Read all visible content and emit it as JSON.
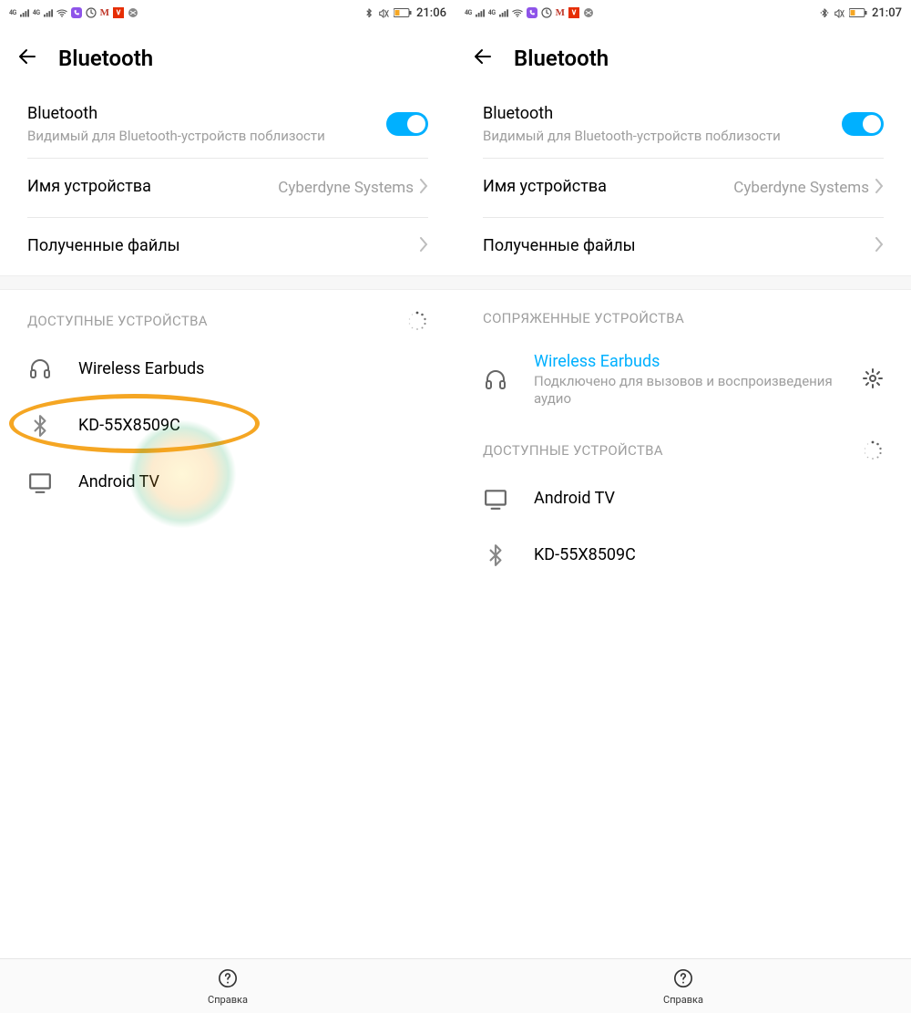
{
  "left": {
    "statusbar": {
      "time": "21:06"
    },
    "page_title": "Bluetooth",
    "toggle": {
      "title": "Bluetooth",
      "subtitle": "Видимый для Bluetooth-устройств поблизости"
    },
    "device_name_row": {
      "label": "Имя устройства",
      "value": "Cyberdyne Systems"
    },
    "received_files_row": {
      "label": "Полученные файлы"
    },
    "available_section": {
      "title": "ДОСТУПНЫЕ УСТРОЙСТВА"
    },
    "devices": [
      {
        "icon": "headphones",
        "name": "Wireless Earbuds"
      },
      {
        "icon": "bluetooth",
        "name": "KD-55X8509C"
      },
      {
        "icon": "display",
        "name": "Android TV"
      }
    ],
    "help_label": "Справка"
  },
  "right": {
    "statusbar": {
      "time": "21:07"
    },
    "page_title": "Bluetooth",
    "toggle": {
      "title": "Bluetooth",
      "subtitle": "Видимый для Bluetooth-устройств поблизости"
    },
    "device_name_row": {
      "label": "Имя устройства",
      "value": "Cyberdyne Systems"
    },
    "received_files_row": {
      "label": "Полученные файлы"
    },
    "paired_section": {
      "title": "СОПРЯЖЕННЫЕ УСТРОЙСТВА"
    },
    "paired_device": {
      "icon": "headphones",
      "name": "Wireless Earbuds",
      "subtitle": "Подключено для вызовов и воспроизведения аудио"
    },
    "available_section": {
      "title": "ДОСТУПНЫЕ УСТРОЙСТВА"
    },
    "available_devices": [
      {
        "icon": "display",
        "name": "Android TV"
      },
      {
        "icon": "bluetooth",
        "name": "KD-55X8509C"
      }
    ],
    "help_label": "Справка"
  }
}
